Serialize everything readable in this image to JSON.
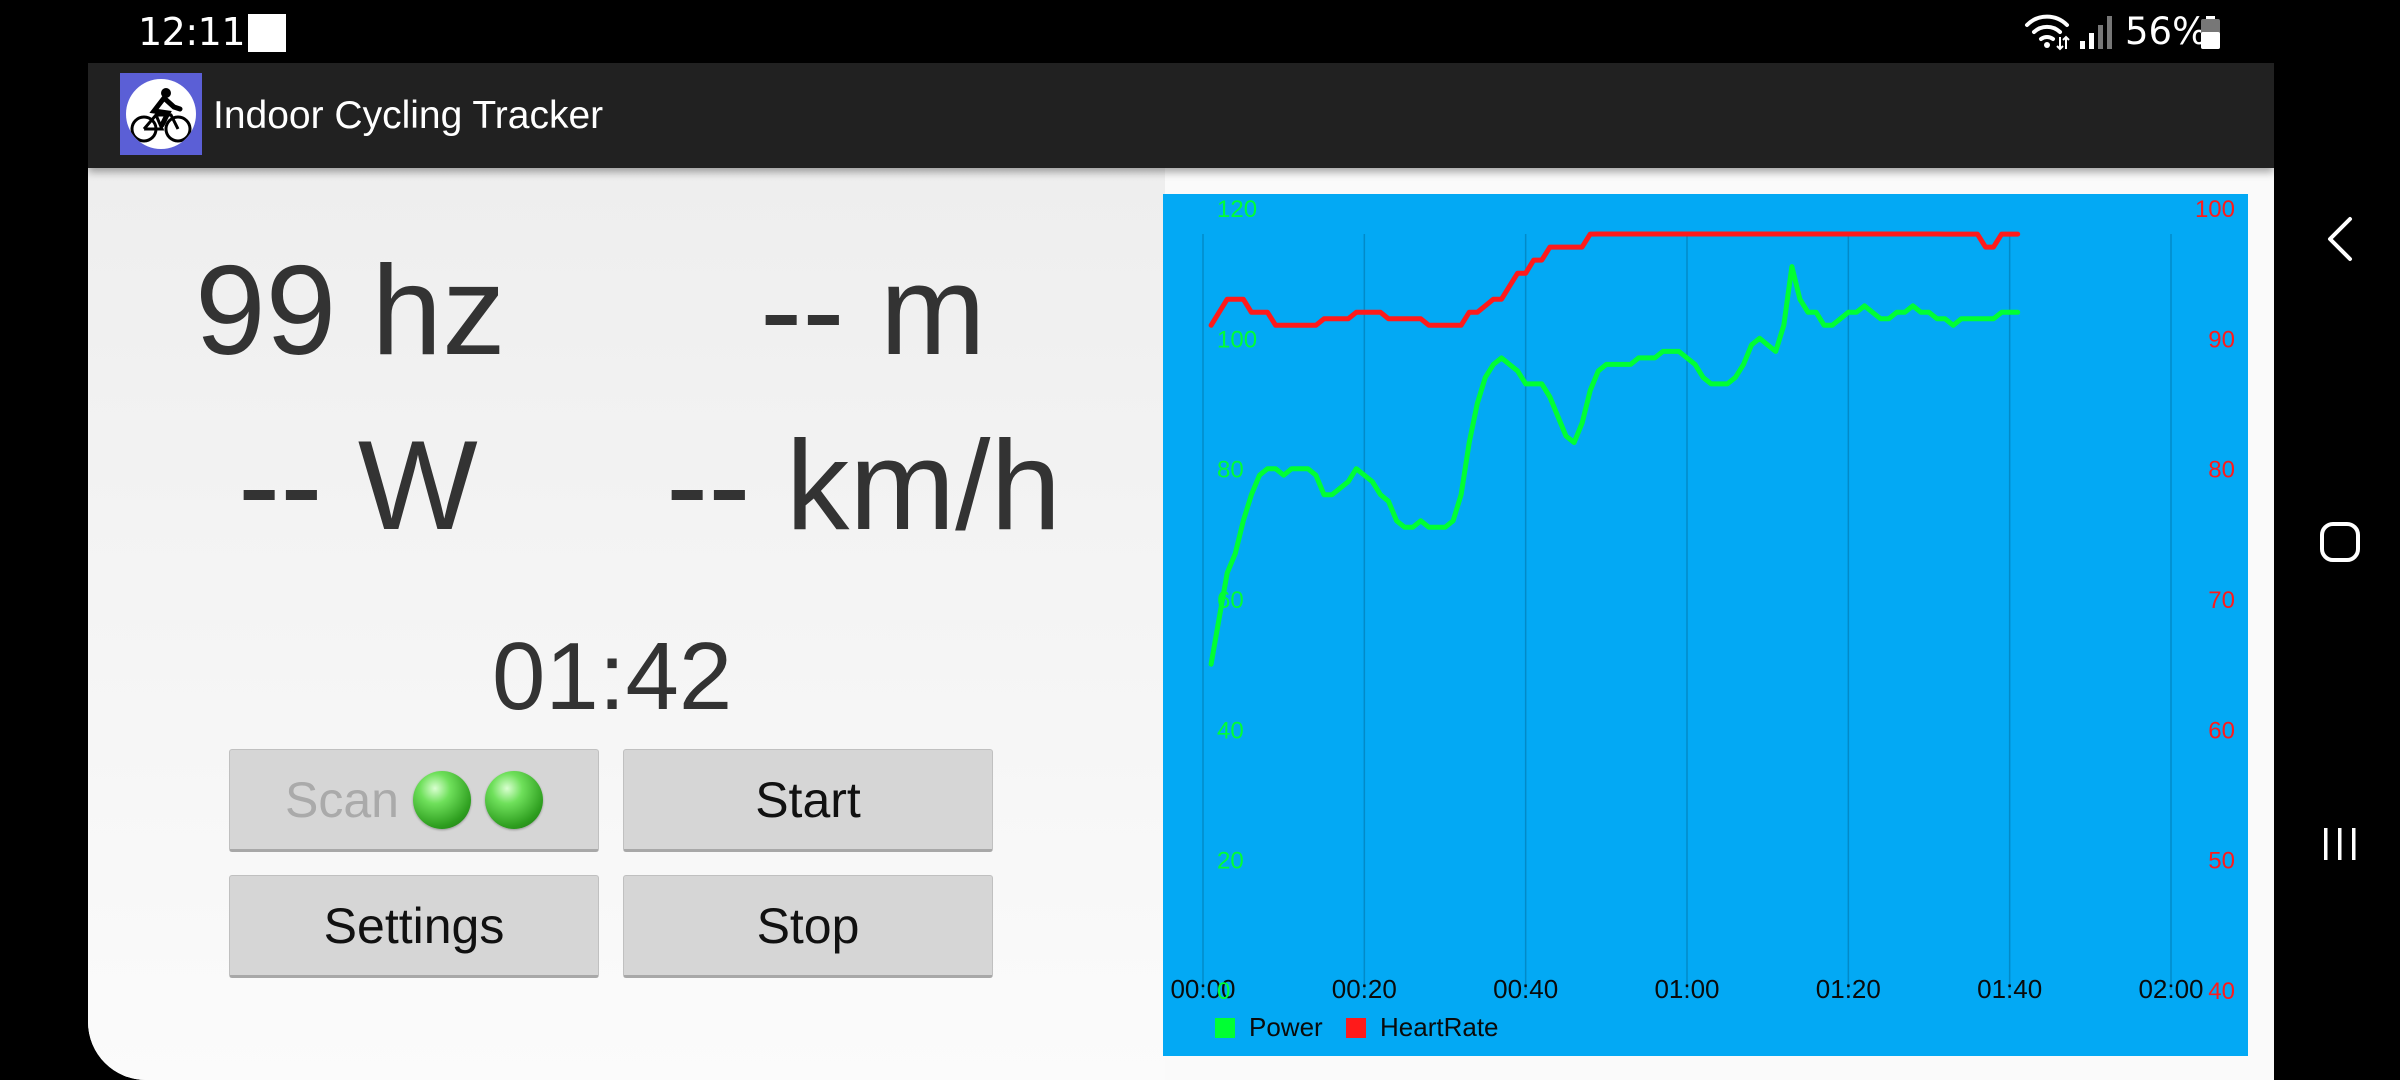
{
  "status_bar": {
    "time": "12:11",
    "battery_percent": "56%",
    "icons": [
      "notification-square-icon",
      "wifi-icon",
      "signal-icon",
      "battery-icon"
    ]
  },
  "app": {
    "title": "Indoor Cycling Tracker",
    "icon": "cyclist-logo-icon"
  },
  "metrics": {
    "cadence": "99 hz",
    "distance": "-- m",
    "power": "-- W",
    "speed": "-- km/h",
    "elapsed_time": "01:42"
  },
  "buttons": {
    "scan_label": "Scan",
    "scan_enabled": false,
    "start_label": "Start",
    "settings_label": "Settings",
    "stop_label": "Stop"
  },
  "colors": {
    "chart_background": "#03a9f4",
    "power_series": "#00ff33",
    "heartrate_series": "#ff1a1a",
    "left_axis": "#00ff33",
    "right_axis": "#ff1a1a",
    "status_led": "#3bbf2a"
  },
  "chart_data": {
    "type": "line",
    "x_tick_labels": [
      "00:00",
      "00:20",
      "00:40",
      "01:00",
      "01:20",
      "01:40",
      "02:00"
    ],
    "xlim": [
      0,
      120
    ],
    "y_left_ticks": [
      "0",
      "20",
      "40",
      "60",
      "80",
      "100",
      "120"
    ],
    "y_left_lim": [
      0,
      120
    ],
    "y_right_ticks": [
      "40",
      "50",
      "60",
      "70",
      "80",
      "90",
      "100"
    ],
    "y_right_lim": [
      40,
      100
    ],
    "grid": "vertical",
    "legend_placement": "bottom-left",
    "series": [
      {
        "name": "Power",
        "axis": "left",
        "points": [
          [
            1,
            50
          ],
          [
            2,
            57
          ],
          [
            3,
            64
          ],
          [
            4,
            67
          ],
          [
            5,
            72
          ],
          [
            6,
            76
          ],
          [
            7,
            79
          ],
          [
            8,
            80
          ],
          [
            9,
            80
          ],
          [
            10,
            79
          ],
          [
            11,
            80
          ],
          [
            12,
            80
          ],
          [
            13,
            80
          ],
          [
            14,
            79
          ],
          [
            15,
            76
          ],
          [
            16,
            76
          ],
          [
            17,
            77
          ],
          [
            18,
            78
          ],
          [
            19,
            80
          ],
          [
            20,
            79
          ],
          [
            21,
            78
          ],
          [
            22,
            76
          ],
          [
            23,
            75
          ],
          [
            24,
            72
          ],
          [
            25,
            71
          ],
          [
            26,
            71
          ],
          [
            27,
            72
          ],
          [
            28,
            71
          ],
          [
            29,
            71
          ],
          [
            30,
            71
          ],
          [
            31,
            72
          ],
          [
            32,
            76
          ],
          [
            33,
            84
          ],
          [
            34,
            90
          ],
          [
            35,
            94
          ],
          [
            36,
            96
          ],
          [
            37,
            97
          ],
          [
            38,
            96
          ],
          [
            39,
            95
          ],
          [
            40,
            93
          ],
          [
            41,
            93
          ],
          [
            42,
            93
          ],
          [
            43,
            91
          ],
          [
            44,
            88
          ],
          [
            45,
            85
          ],
          [
            46,
            84
          ],
          [
            47,
            87
          ],
          [
            48,
            92
          ],
          [
            49,
            95
          ],
          [
            50,
            96
          ],
          [
            51,
            96
          ],
          [
            52,
            96
          ],
          [
            53,
            96
          ],
          [
            54,
            97
          ],
          [
            55,
            97
          ],
          [
            56,
            97
          ],
          [
            57,
            98
          ],
          [
            58,
            98
          ],
          [
            59,
            98
          ],
          [
            60,
            97
          ],
          [
            61,
            96
          ],
          [
            62,
            94
          ],
          [
            63,
            93
          ],
          [
            64,
            93
          ],
          [
            65,
            93
          ],
          [
            66,
            94
          ],
          [
            67,
            96
          ],
          [
            68,
            99
          ],
          [
            69,
            100
          ],
          [
            70,
            99
          ],
          [
            71,
            98
          ],
          [
            72,
            102
          ],
          [
            73,
            111
          ],
          [
            74,
            106
          ],
          [
            75,
            104
          ],
          [
            76,
            104
          ],
          [
            77,
            102
          ],
          [
            78,
            102
          ],
          [
            79,
            103
          ],
          [
            80,
            104
          ],
          [
            81,
            104
          ],
          [
            82,
            105
          ],
          [
            83,
            104
          ],
          [
            84,
            103
          ],
          [
            85,
            103
          ],
          [
            86,
            104
          ],
          [
            87,
            104
          ],
          [
            88,
            105
          ],
          [
            89,
            104
          ],
          [
            90,
            104
          ],
          [
            91,
            103
          ],
          [
            92,
            103
          ],
          [
            93,
            102
          ],
          [
            94,
            103
          ],
          [
            95,
            103
          ],
          [
            96,
            103
          ],
          [
            97,
            103
          ],
          [
            98,
            103
          ],
          [
            99,
            104
          ],
          [
            100,
            104
          ],
          [
            101,
            104
          ]
        ]
      },
      {
        "name": "HeartRate",
        "axis": "right",
        "points": [
          [
            1,
            91
          ],
          [
            2,
            92
          ],
          [
            3,
            93
          ],
          [
            4,
            93
          ],
          [
            5,
            93
          ],
          [
            6,
            92
          ],
          [
            7,
            92
          ],
          [
            8,
            92
          ],
          [
            9,
            91
          ],
          [
            10,
            91
          ],
          [
            11,
            91
          ],
          [
            12,
            91
          ],
          [
            13,
            91
          ],
          [
            14,
            91
          ],
          [
            15,
            91.5
          ],
          [
            16,
            91.5
          ],
          [
            17,
            91.5
          ],
          [
            18,
            91.5
          ],
          [
            19,
            92
          ],
          [
            20,
            92
          ],
          [
            21,
            92
          ],
          [
            22,
            92
          ],
          [
            23,
            91.5
          ],
          [
            24,
            91.5
          ],
          [
            25,
            91.5
          ],
          [
            26,
            91.5
          ],
          [
            27,
            91.5
          ],
          [
            28,
            91
          ],
          [
            29,
            91
          ],
          [
            30,
            91
          ],
          [
            31,
            91
          ],
          [
            32,
            91
          ],
          [
            33,
            92
          ],
          [
            34,
            92
          ],
          [
            35,
            92.5
          ],
          [
            36,
            93
          ],
          [
            37,
            93
          ],
          [
            38,
            94
          ],
          [
            39,
            95
          ],
          [
            40,
            95
          ],
          [
            41,
            96
          ],
          [
            42,
            96
          ],
          [
            43,
            97
          ],
          [
            44,
            97
          ],
          [
            45,
            97
          ],
          [
            46,
            97
          ],
          [
            47,
            97
          ],
          [
            48,
            98
          ],
          [
            49,
            99
          ],
          [
            50,
            100
          ],
          [
            51,
            101
          ],
          [
            52,
            101
          ],
          [
            53,
            101
          ],
          [
            54,
            101
          ],
          [
            55,
            101
          ],
          [
            56,
            101
          ],
          [
            57,
            101
          ],
          [
            58,
            101
          ],
          [
            59,
            100
          ],
          [
            60,
            100
          ],
          [
            61,
            100
          ],
          [
            62,
            101
          ],
          [
            63,
            101
          ],
          [
            64,
            101
          ],
          [
            65,
            101
          ],
          [
            66,
            101
          ],
          [
            67,
            101
          ],
          [
            68,
            101
          ],
          [
            69,
            101
          ],
          [
            70,
            101
          ],
          [
            71,
            101
          ],
          [
            72,
            101
          ],
          [
            73,
            101
          ],
          [
            74,
            101
          ],
          [
            75,
            101
          ],
          [
            76,
            101
          ],
          [
            77,
            101
          ],
          [
            78,
            101
          ],
          [
            79,
            101
          ],
          [
            80,
            101
          ],
          [
            81,
            101
          ],
          [
            82,
            101
          ],
          [
            83,
            101
          ],
          [
            84,
            101
          ],
          [
            85,
            101
          ],
          [
            86,
            101
          ],
          [
            87,
            101
          ],
          [
            88,
            100
          ],
          [
            89,
            100
          ],
          [
            90,
            99
          ],
          [
            91,
            99
          ],
          [
            92,
            98
          ],
          [
            93,
            98
          ],
          [
            94,
            98
          ],
          [
            95,
            98
          ],
          [
            96,
            98
          ],
          [
            97,
            97
          ],
          [
            98,
            97
          ],
          [
            99,
            98
          ],
          [
            100,
            98
          ],
          [
            101,
            98
          ]
        ]
      }
    ]
  }
}
